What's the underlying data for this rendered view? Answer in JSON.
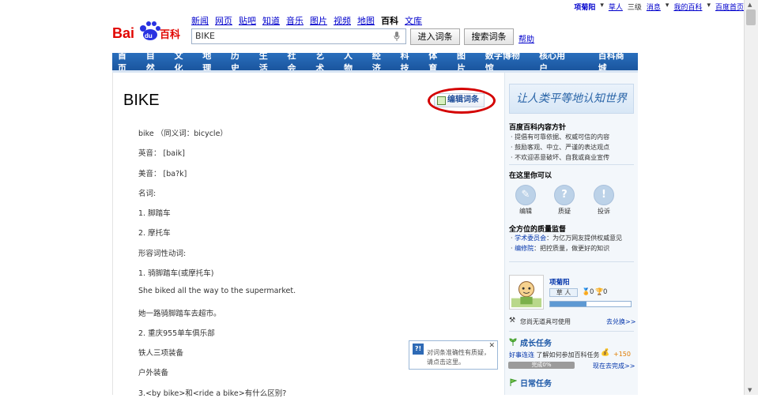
{
  "topbar": {
    "username": "项菊阳",
    "items": [
      "草人",
      "三级",
      "消息",
      "我的百科",
      "百度首页"
    ]
  },
  "logo": {
    "text": "Baidu百科"
  },
  "nav_links": [
    "新闻",
    "网页",
    "贴吧",
    "知道",
    "音乐",
    "图片",
    "视频",
    "地图",
    "百科",
    "文库"
  ],
  "nav_current": "百科",
  "search": {
    "value": "BIKE",
    "enter_label": "进入词条",
    "search_label": "搜索词条",
    "help_label": "帮助"
  },
  "main_nav": [
    "首页",
    "自然",
    "文化",
    "地理",
    "历史",
    "生活",
    "社会",
    "艺术",
    "人物",
    "经济",
    "科技",
    "体育",
    "图片",
    "数字博物馆",
    "核心用户",
    "百科商城"
  ],
  "article": {
    "title": "BIKE",
    "edit_label": "编辑词条",
    "lines": [
      "bike （同义词：bicycle）",
      "英音： [baik]",
      "美音： [ba?k]",
      "名词:",
      "1. 脚踏车",
      "2. 摩托车",
      "形容词性动词:",
      "1. 骑脚踏车(或摩托车)",
      "She biked all the way to the supermarket.",
      "她一路骑脚踏车去超市。",
      "2. 重庆955单车俱乐部",
      "铁人三项装备",
      "户外装备",
      "3.<by bike>和<ride a bike>有什么区别?"
    ]
  },
  "sidebar": {
    "slogan": "让人类平等地认知世界",
    "policy_title": "百度百科内容方针",
    "policy_items": [
      "提倡有可靠依据、权威可信的内容",
      "鼓励客观、中立、严谨的表达观点",
      "不欢迎恶意破坏、自我或商业宣传"
    ],
    "can_do_title": "在这里你可以",
    "actions": [
      "编辑",
      "质疑",
      "投诉"
    ],
    "quality_title": "全方位的质量监督",
    "quality_items": [
      {
        "link": "学术委员会",
        "text": "：为亿万网友提供权威意见"
      },
      {
        "link": "编修院",
        "text": "：把控质量，做更好的知识"
      }
    ],
    "user": {
      "name": "项菊阳",
      "rank": "草  人",
      "badge1": "0",
      "badge2": "0",
      "exp_fraction": 0.45
    },
    "tool_text": "您尚无道具可使用",
    "tool_link": "去兑换>>",
    "growth_title": "成长任务",
    "growth_link": "好事连连",
    "growth_text": "了解如何参加百科任务",
    "growth_points": "+150",
    "progress_text": "完成0%",
    "complete_link": "现在去完成>>",
    "daily_title": "日常任务"
  },
  "tooltip": {
    "text_line1": "对词条准确性有质疑，",
    "text_line2": "请点击这里。"
  }
}
